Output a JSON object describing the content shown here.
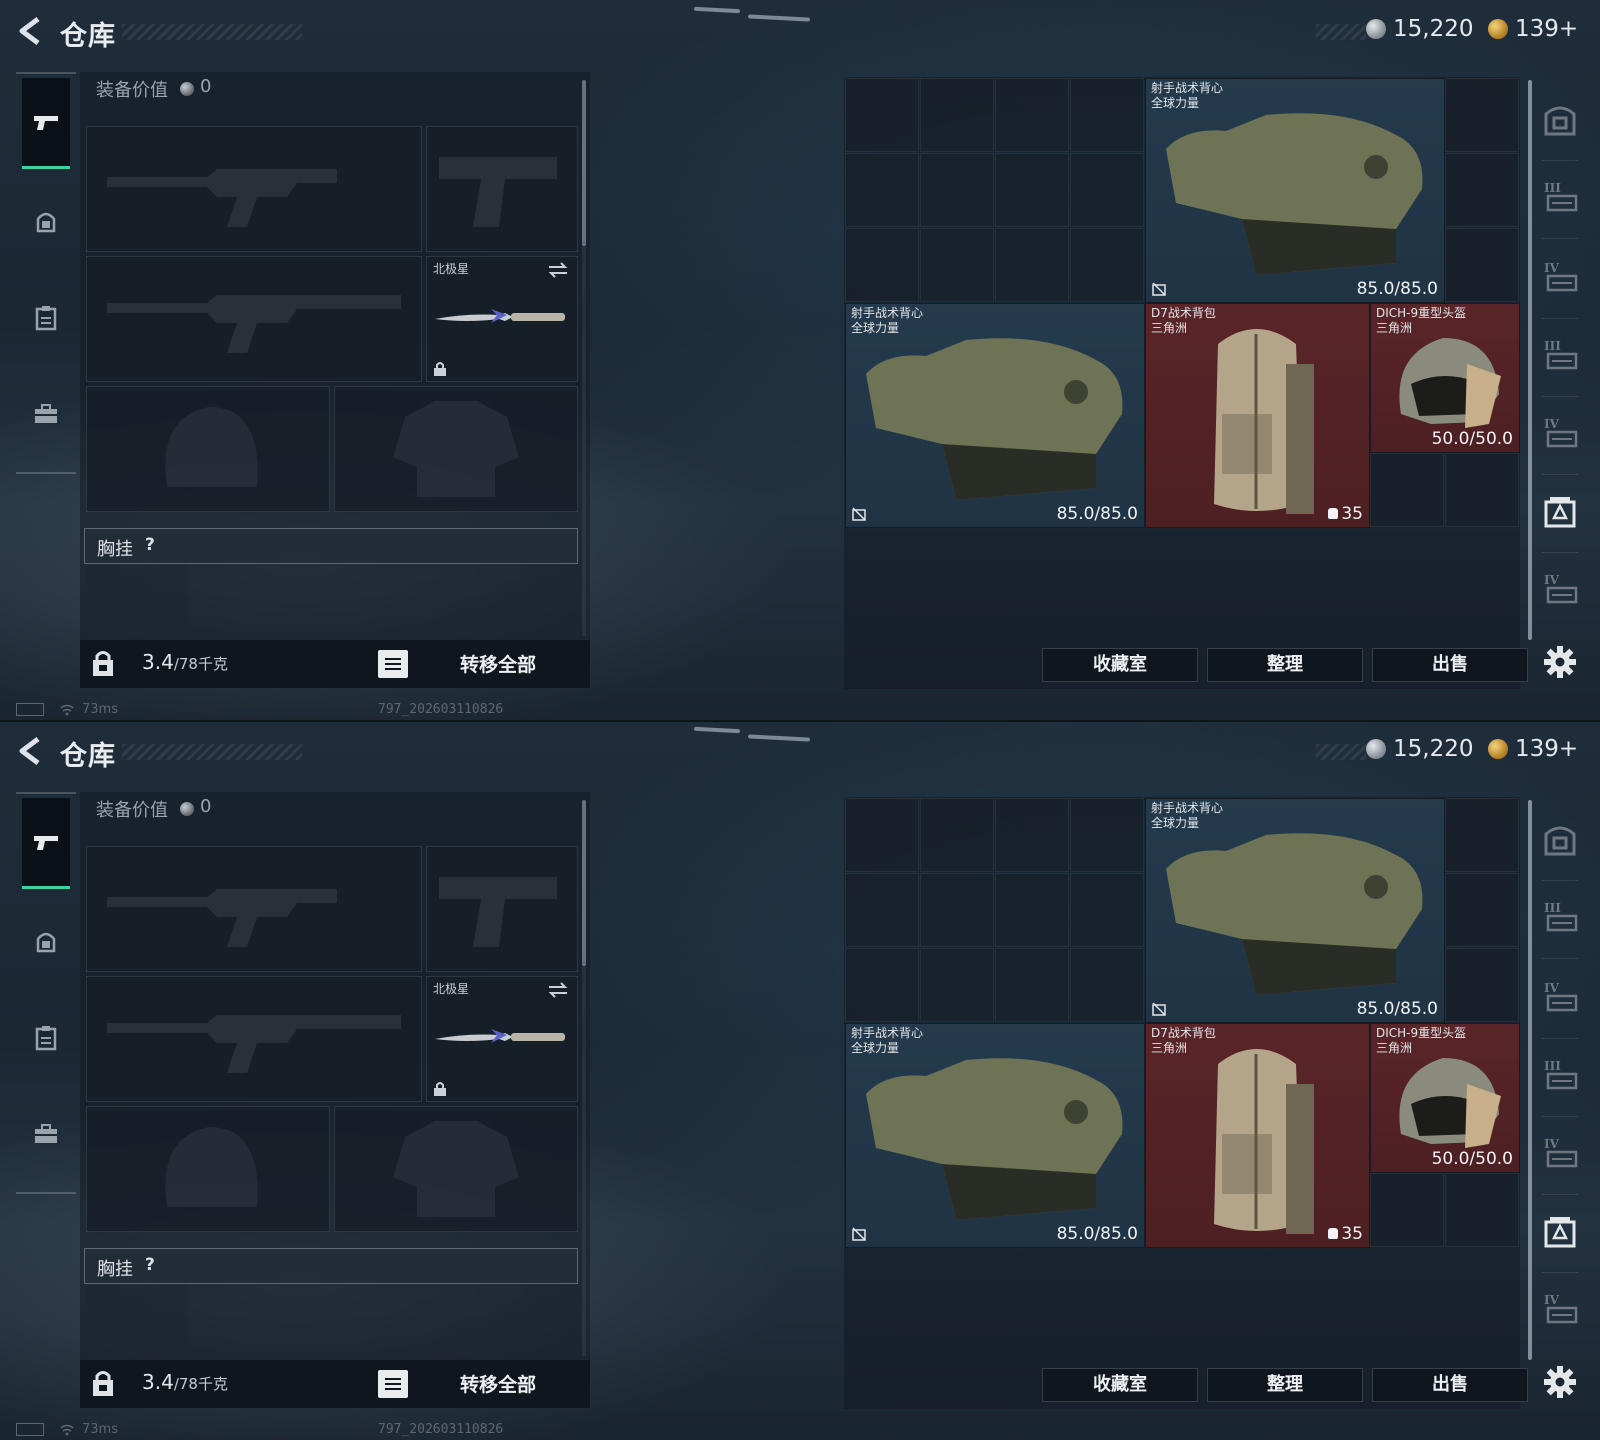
{
  "header": {
    "title": "仓库",
    "currency_silver": "15,220",
    "currency_gold": "139+"
  },
  "equipment": {
    "value_label": "装备价值",
    "value": "0",
    "melee_slot_label": "北极星",
    "chest_rig_label": "胸挂",
    "chest_rig_help": "?",
    "weight_current": "3.4",
    "weight_capacity": "/78千克",
    "transfer_all_label": "转移全部"
  },
  "status": {
    "ping": "73ms",
    "build_id": "797_202603110826"
  },
  "storage": {
    "items": [
      {
        "name": "射手战术背心",
        "sub": "全球力量",
        "durability": "85.0/85.0",
        "rarity": "blue",
        "icon": "armor-vest"
      },
      {
        "name": "射手战术背心",
        "sub": "全球力量",
        "durability": "85.0/85.0",
        "rarity": "blue",
        "icon": "armor-vest"
      },
      {
        "name": "D7战术背包",
        "sub": "三角洲",
        "count": "35",
        "rarity": "red",
        "icon": "backpack"
      },
      {
        "name": "DICH-9重型头盔",
        "sub": "三角洲",
        "durability": "50.0/50.0",
        "rarity": "red",
        "icon": "helmet"
      }
    ],
    "actions": {
      "collection": "收藏室",
      "sort": "整理",
      "sell": "出售"
    }
  },
  "colors": {
    "accent": "#3ad29f",
    "rarity_blue": "#243b4d",
    "rarity_red": "#5a2529",
    "panel_bg": "#1b2834"
  },
  "nav_icons": [
    "pistol-icon",
    "helmet-icon",
    "clipboard-icon",
    "toolbox-icon"
  ],
  "rail_icons": [
    "safe-box-icon",
    "tier-3-vest-icon",
    "tier-4-gun-icon",
    "tier-3-gun-icon",
    "tier-4-box-icon",
    "tier-crate-icon",
    "tier-4-case-icon",
    "settings-icon"
  ]
}
